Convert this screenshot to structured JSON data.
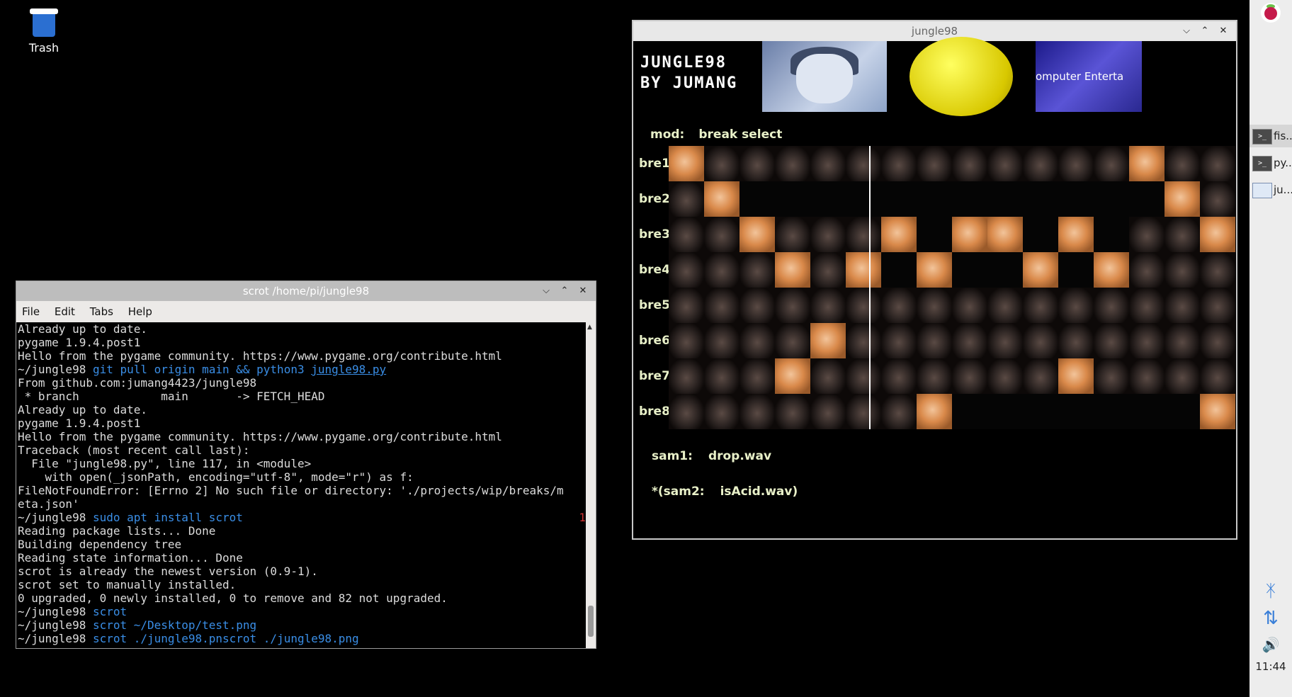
{
  "desktop": {
    "trash_label": "Trash"
  },
  "terminal": {
    "title": "scrot /home/pi/jungle98",
    "menu": [
      "File",
      "Edit",
      "Tabs",
      "Help"
    ],
    "lines": [
      "Already up to date.",
      "pygame 1.9.4.post1",
      "Hello from the pygame community. https://www.pygame.org/contribute.html",
      "~/jungle98 git pull origin main && python3 jungle98.py",
      "From github.com:jumang4423/jungle98",
      " * branch            main       -> FETCH_HEAD",
      "Already up to date.",
      "pygame 1.9.4.post1",
      "Hello from the pygame community. https://www.pygame.org/contribute.html",
      "Traceback (most recent call last):",
      "  File \"jungle98.py\", line 117, in <module>",
      "    with open(_jsonPath, encoding=\"utf-8\", mode=\"r\") as f:",
      "FileNotFoundError: [Errno 2] No such file or directory: './projects/wip/breaks/m",
      "eta.json'",
      "~/jungle98 sudo apt install scrot",
      "Reading package lists... Done",
      "Building dependency tree",
      "Reading state information... Done",
      "scrot is already the newest version (0.9-1).",
      "scrot set to manually installed.",
      "0 upgraded, 0 newly installed, 0 to remove and 82 not upgraded.",
      "~/jungle98 scrot",
      "~/jungle98 scrot ~/Desktop/test.png",
      "~/jungle98 scrot ./jungle98.png"
    ],
    "exit_code": "1"
  },
  "jungle": {
    "title": "jungle98",
    "banner_line1": "JUNGLE98",
    "banner_line2": "BY JUMANG",
    "image3_text": "omputer Enterta",
    "mod_label": "mod:",
    "mod_value": "break select",
    "rows": [
      {
        "label": "bre1",
        "on": [
          0,
          13
        ]
      },
      {
        "label": "bre2",
        "on": [
          1,
          14
        ]
      },
      {
        "label": "bre3",
        "on": [
          2,
          6,
          8,
          9,
          11,
          15
        ]
      },
      {
        "label": "bre4",
        "on": [
          3,
          5,
          7,
          10,
          12
        ]
      },
      {
        "label": "bre5",
        "on": []
      },
      {
        "label": "bre6",
        "on": [
          4
        ]
      },
      {
        "label": "bre7",
        "on": [
          3,
          11
        ]
      },
      {
        "label": "bre8",
        "on": [
          7,
          15
        ]
      }
    ],
    "blank": {
      "bre2": [
        2,
        3,
        4,
        5,
        6,
        7,
        8,
        9,
        10,
        11,
        12,
        13
      ],
      "bre3": [
        7,
        10,
        12
      ],
      "bre4": [
        6,
        8,
        9,
        11
      ],
      "bre8": [
        8,
        9,
        10,
        11,
        12,
        13,
        14
      ]
    },
    "steps": 16,
    "sam1_label": "sam1:",
    "sam1_value": "drop.wav",
    "sam2_label": "*(sam2:",
    "sam2_value": "isAcid.wav)"
  },
  "panel": {
    "tasks": [
      {
        "label": "fis...",
        "icon": ">_"
      },
      {
        "label": "py...",
        "icon": ">_"
      },
      {
        "label": "ju...",
        "icon": ""
      }
    ],
    "clock": "11:44"
  }
}
